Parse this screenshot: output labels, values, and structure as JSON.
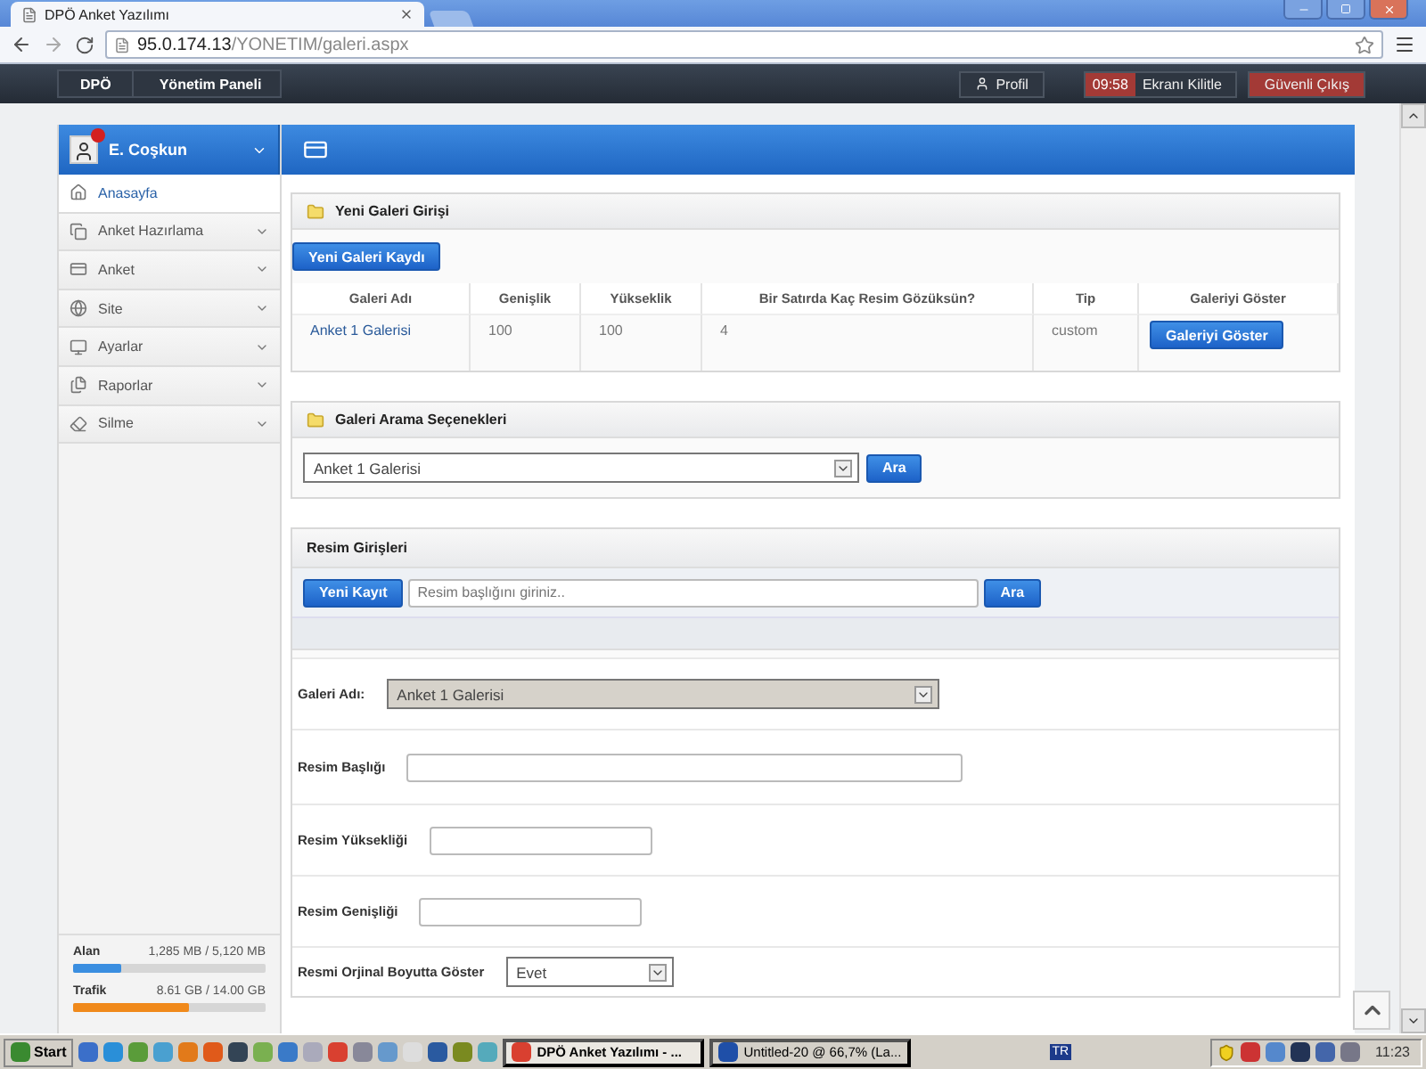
{
  "browser": {
    "tab_title": "DPÖ Anket Yazılımı",
    "url_host": "95.0.174.13",
    "url_path": "/YONETIM/galeri.aspx"
  },
  "navbar": {
    "breadcrumb": [
      "DPÖ",
      "Yönetim Paneli"
    ],
    "profile": "Profil",
    "timer": "09:58",
    "lock": "Ekranı Kilitle",
    "logout": "Güvenli Çıkış"
  },
  "user": {
    "name": "E. Coşkun"
  },
  "sidebar": {
    "items": [
      {
        "label": "Anasayfa",
        "selected": true,
        "expandable": false
      },
      {
        "label": "Anket Hazırlama",
        "selected": false,
        "expandable": true
      },
      {
        "label": "Anket",
        "selected": false,
        "expandable": true
      },
      {
        "label": "Site",
        "selected": false,
        "expandable": true
      },
      {
        "label": "Ayarlar",
        "selected": false,
        "expandable": true
      },
      {
        "label": "Raporlar",
        "selected": false,
        "expandable": true
      },
      {
        "label": "Silme",
        "selected": false,
        "expandable": true
      }
    ]
  },
  "usage": [
    {
      "label": "Alan",
      "reading": "1,285 MB / 5,120 MB",
      "level": 0.25,
      "color": "#3a8ee0"
    },
    {
      "label": "Trafik",
      "reading": "8.61 GB / 14.00 GB",
      "level": 0.6,
      "color": "#f0891a"
    }
  ],
  "new_gallery": {
    "title": "Yeni Galeri Girişi",
    "button": "Yeni Galeri Kaydı",
    "table": {
      "columns": [
        "Galeri Adı",
        "Genişlik",
        "Yükseklik",
        "Bir Satırda Kaç Resim Gözüksün?",
        "Tip",
        "Galeriyi Göster"
      ],
      "rows": [
        {
          "cells": [
            "Anket 1 Galerisi",
            "100",
            "100",
            "4",
            "custom"
          ],
          "action": "Galeriyi Göster"
        }
      ]
    }
  },
  "search": {
    "title": "Galeri Arama Seçenekleri",
    "select": "Anket 1 Galerisi",
    "button": "Ara"
  },
  "images": {
    "title": "Resim Girişleri",
    "new_button": "Yeni Kayıt",
    "placeholder": "Resim başlığını giriniz..",
    "search_button": "Ara",
    "fields": [
      {
        "label": "Galeri Adı:",
        "kind": "select",
        "value": "Anket 1 Galerisi",
        "disabled": true
      },
      {
        "label": "Resim Başlığı",
        "kind": "text"
      },
      {
        "label": "Resim Yüksekliği",
        "kind": "text"
      },
      {
        "label": "Resim Genişliği",
        "kind": "text"
      },
      {
        "label": "Resmi Orjinal Boyutta Göster",
        "kind": "select",
        "value": "Evet",
        "disabled": false
      }
    ]
  },
  "taskbar": {
    "start": "Start",
    "tasks": [
      {
        "label": "DPÖ Anket Yazılımı - ...",
        "selected": true
      },
      {
        "label": "Untitled-20 @ 66,7% (La...",
        "selected": false
      }
    ],
    "language": "TR",
    "clock": "11:23"
  }
}
